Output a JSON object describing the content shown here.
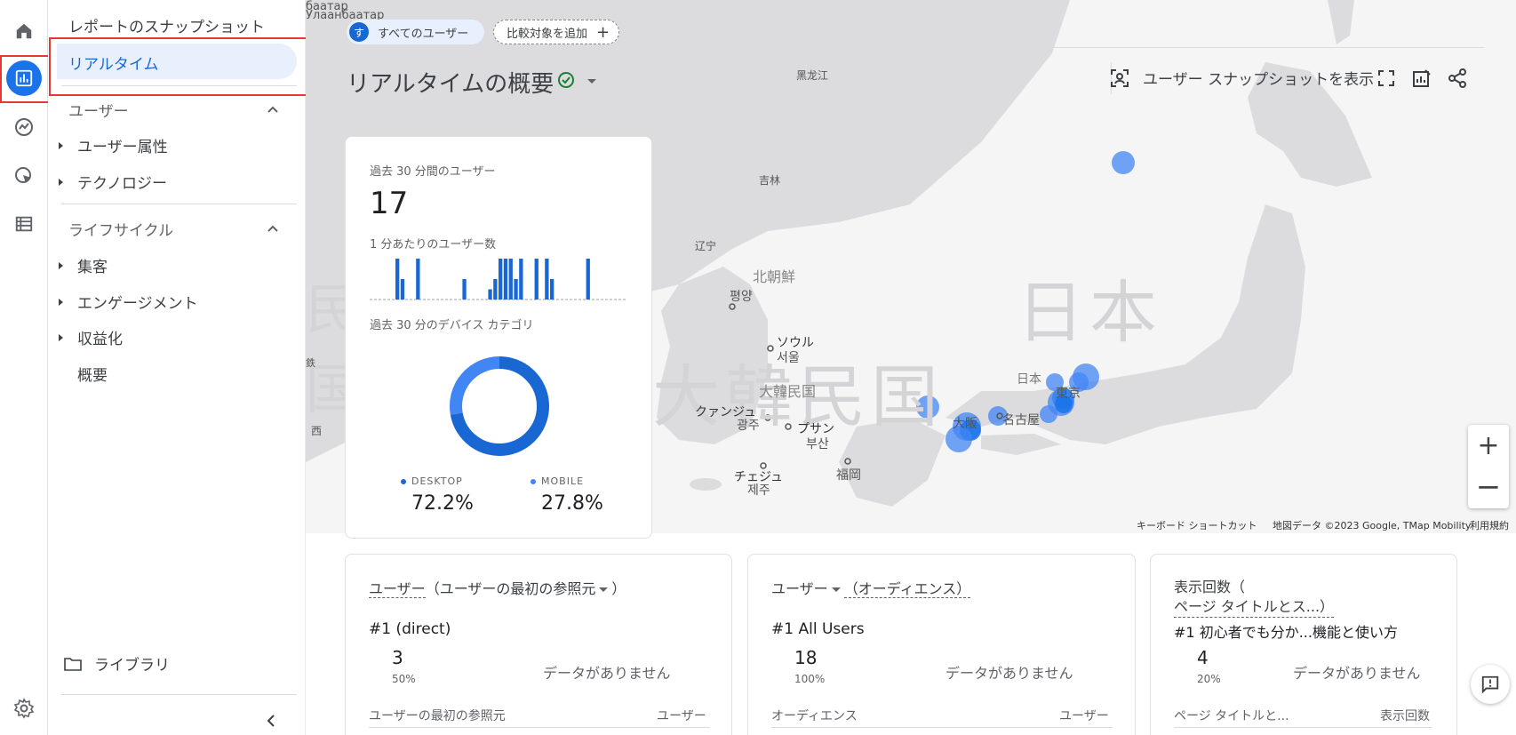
{
  "rail": {
    "icons": [
      "home-icon",
      "reports-icon",
      "explore-icon",
      "advertising-icon",
      "configure-icon",
      "settings-icon"
    ]
  },
  "nav": {
    "snapshot": "レポートのスナップショット",
    "realtime": "リアルタイム",
    "user_section": "ユーザー",
    "user_attr": "ユーザー属性",
    "technology": "テクノロジー",
    "lifecycle_section": "ライフサイクル",
    "acquisition": "集客",
    "engagement": "エンゲージメント",
    "monetization": "収益化",
    "overview": "概要",
    "library": "ライブラリ"
  },
  "header": {
    "segment_avatar": "す",
    "segment_label": "すべてのユーザー",
    "compare_label": "比較対象を追加",
    "page_title": "リアルタイムの概要",
    "snapshot_label": "ユーザー スナップショットを表示"
  },
  "map": {
    "labels": {
      "mongolia": "Улаанбаатар",
      "mongolia_top": "баатар",
      "heilongjiang": "黑龙江",
      "jilin": "吉林",
      "liaoning": "辽宁",
      "north_korea": "北朝鮮",
      "pyongyang": "평양",
      "seoul_kana": "ソウル",
      "seoul": "서울",
      "south_korea": "大韓民国",
      "gwangju_kana": "クァンジュ",
      "gwangju": "광주",
      "busan_kana": "プサン",
      "busan": "부산",
      "jeju_kana": "チェジュ",
      "jeju": "제주",
      "fukuoka": "福岡",
      "japan": "日本",
      "tokyo": "東京",
      "nagoya": "名古屋",
      "osaka": "大阪",
      "big_japan": "日本",
      "big_korea": "大韓民国",
      "left_edge": "国",
      "left_edge2": "民",
      "left_small": "西",
      "left_small2": "鉄"
    },
    "footer": {
      "shortcuts": "キーボード ショートカット",
      "map_data": "地図データ ©2023 Google, TMap Mobility",
      "terms": "利用規約"
    },
    "zoom_in": "+",
    "zoom_out": "−"
  },
  "main_card": {
    "users_label": "過去 30 分間のユーザー",
    "users_value": "17",
    "per_minute_label": "1 分あたりのユーザー数",
    "per_minute_values": [
      0,
      0,
      0,
      0,
      0,
      4,
      2,
      0,
      0,
      4,
      0,
      0,
      0,
      0,
      0,
      0,
      0,
      0,
      2,
      0,
      0,
      0,
      0,
      1,
      2,
      4,
      4,
      4,
      2,
      4,
      0,
      0,
      4,
      0,
      4,
      2,
      0,
      0,
      0,
      0,
      0,
      0,
      4,
      0,
      0,
      0,
      0,
      0,
      0,
      0
    ],
    "device_label": "過去 30 分のデバイス カテゴリ",
    "desktop_label": "DESKTOP",
    "desktop_value": "72.2%",
    "desktop_fraction": 0.722,
    "mobile_label": "MOBILE",
    "mobile_value": "27.8%",
    "colors": {
      "desktop": "#1967d2",
      "mobile": "#4285f4"
    }
  },
  "cards": [
    {
      "title_a": "ユーザー",
      "title_b": "（ユーザーの最初の参照元",
      "title_c": "）",
      "rank": "#1",
      "top_label": "(direct)",
      "value": "3",
      "pct": "50%",
      "nodata": "データがありません",
      "col_left": "ユーザーの最初の参照元",
      "col_right": "ユーザー"
    },
    {
      "title_a": "ユーザー",
      "title_b": "（オーディエンス）",
      "rank": "#1",
      "top_label": "All Users",
      "value": "18",
      "pct": "100%",
      "nodata": "データがありません",
      "col_left": "オーディエンス",
      "col_right": "ユーザー"
    },
    {
      "title_a": "表示回数（",
      "title_b": "ページ タイトルとス...）",
      "rank": "#1",
      "top_label": "初心者でも分か...機能と使い方",
      "value": "4",
      "pct": "20%",
      "nodata": "データがありません",
      "col_left": "ページ タイトルと...",
      "col_right": "表示回数"
    }
  ]
}
